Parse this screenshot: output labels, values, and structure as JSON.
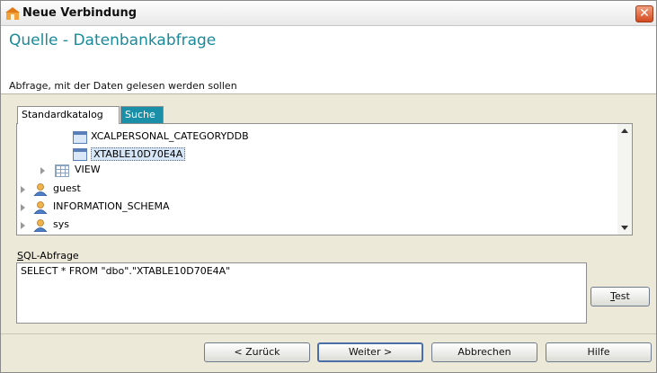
{
  "window": {
    "title": "Neue Verbindung",
    "close_glyph": "✕"
  },
  "header": {
    "title": "Quelle - Datenbankabfrage",
    "subtitle": "Abfrage, mit der Daten gelesen werden sollen"
  },
  "tabs": [
    {
      "label": "Standardkatalog",
      "active": true
    },
    {
      "label": "Suche",
      "active": false
    }
  ],
  "tree": [
    {
      "label": "XCALPERSONAL_CATEGORYDDB",
      "icon": "table-icon",
      "selected": false
    },
    {
      "label": "XTABLE10D70E4A",
      "icon": "table-icon",
      "selected": true
    },
    {
      "label": "VIEW",
      "icon": "view-icon",
      "selected": false
    },
    {
      "label": "guest",
      "icon": "user-icon",
      "selected": false
    },
    {
      "label": "INFORMATION_SCHEMA",
      "icon": "user-icon",
      "selected": false
    },
    {
      "label": "sys",
      "icon": "user-icon",
      "selected": false
    }
  ],
  "sql": {
    "label_underlined": "S",
    "label_rest": "QL-Abfrage",
    "query": "SELECT * FROM \"dbo\".\"XTABLE10D70E4A\""
  },
  "buttons": {
    "test_underlined": "T",
    "test_rest": "est",
    "back": "< Zurück",
    "next": "Weiter >",
    "cancel": "Abbrechen",
    "help": "Hilfe"
  },
  "colors": {
    "accent": "#1a8a9a",
    "tab_inactive": "#1a8fa8"
  }
}
